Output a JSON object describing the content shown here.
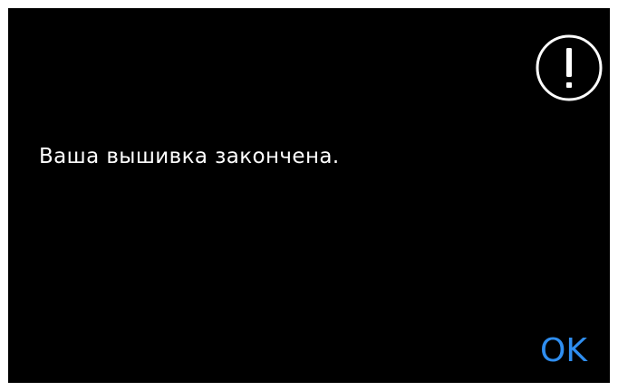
{
  "dialog": {
    "icon": "exclamation-circle-icon",
    "message": "Ваша вышивка закончена.",
    "ok_label": "OK"
  },
  "colors": {
    "background": "#000000",
    "text": "#ffffff",
    "accent": "#2f8ef0"
  }
}
